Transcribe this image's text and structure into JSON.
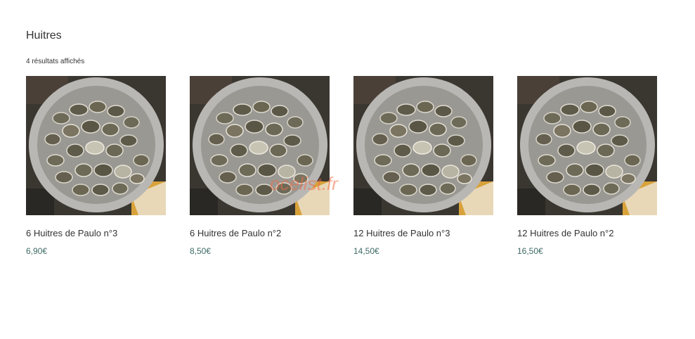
{
  "category": {
    "title": "Huitres",
    "result_count": "4 résultats affichés"
  },
  "products": [
    {
      "name": "6 Huitres de Paulo n°3",
      "price": "6,90€",
      "image_icon": "oyster-platter-photo"
    },
    {
      "name": "6 Huitres de Paulo n°2",
      "price": "8,50€",
      "image_icon": "oyster-platter-photo"
    },
    {
      "name": "12 Huitres de Paulo n°3",
      "price": "14,50€",
      "image_icon": "oyster-platter-photo"
    },
    {
      "name": "12 Huitres de Paulo n°2",
      "price": "16,50€",
      "image_icon": "oyster-platter-photo"
    }
  ],
  "watermark": "ocelist.fr",
  "colors": {
    "price": "#3d6b66",
    "text": "#333333",
    "watermark": "#f06e46"
  }
}
